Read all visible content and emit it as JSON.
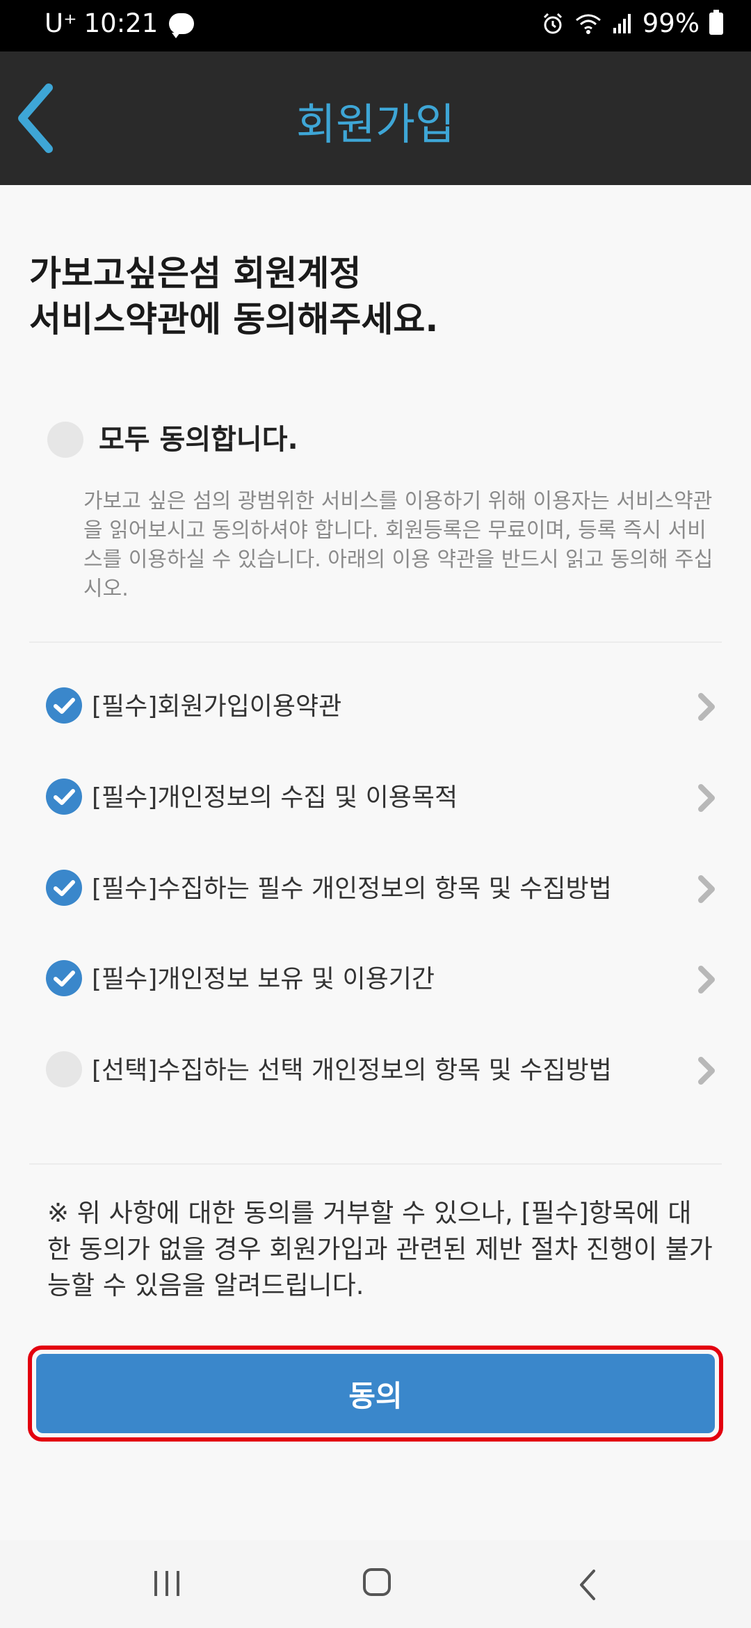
{
  "status_bar": {
    "carrier": "U⁺",
    "time": "10:21",
    "battery": "99%"
  },
  "header": {
    "title": "회원가입"
  },
  "headline": {
    "line1": "가보고싶은섬 회원계정",
    "line2": "서비스약관에 동의해주세요."
  },
  "agree_all": {
    "label": "모두 동의합니다.",
    "checked": false
  },
  "description": "가보고 싶은 섬의 광범위한 서비스를 이용하기 위해 이용자는 서비스약관을 읽어보시고 동의하셔야 합니다. 회원등록은 무료이며, 등록 즉시 서비스를 이용하실 수 있습니다. 아래의 이용 약관을 반드시 읽고 동의해 주십시오.",
  "terms": [
    {
      "label": "[필수]회원가입이용약관",
      "checked": true
    },
    {
      "label": "[필수]개인정보의 수집 및 이용목적",
      "checked": true
    },
    {
      "label": "[필수]수집하는 필수 개인정보의 항목 및 수집방법",
      "checked": true
    },
    {
      "label": "[필수]개인정보 보유 및 이용기간",
      "checked": true
    },
    {
      "label": "[선택]수집하는 선택 개인정보의 항목 및 수집방법",
      "checked": false
    }
  ],
  "notice": "※ 위 사항에 대한 동의를 거부할 수 있으나, [필수]항목에 대한 동의가 없을 경우 회원가입과 관련된 제반 절차 진행이 불가능할 수 있음을 알려드립니다.",
  "agree_button": {
    "label": "동의"
  },
  "colors": {
    "accent": "#3a87cb",
    "header_title": "#3ea6d6",
    "highlight_border": "#e3000f"
  },
  "icons": {
    "back": "back-chevron-icon",
    "check": "check-icon",
    "row_chevron": "chevron-right-icon"
  }
}
